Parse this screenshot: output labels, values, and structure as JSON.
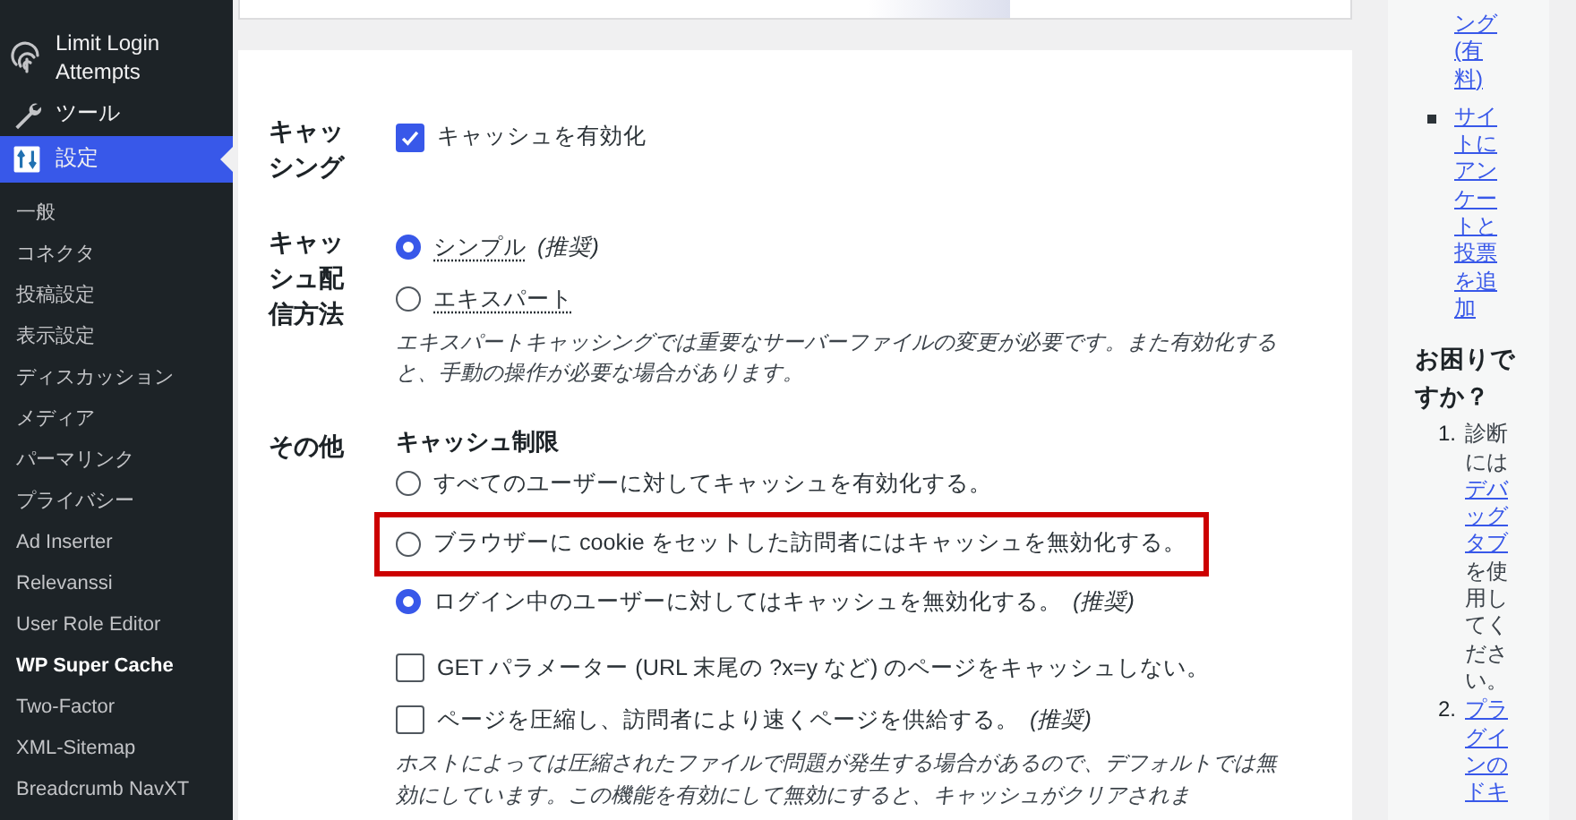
{
  "sidebar": {
    "menu": [
      {
        "label": "Limit Login Attempts",
        "selected": false
      },
      {
        "label": "ツール",
        "selected": false
      },
      {
        "label": "設定",
        "selected": true
      }
    ],
    "submenu": [
      {
        "label": "一般",
        "selected": false
      },
      {
        "label": "コネクタ",
        "selected": false
      },
      {
        "label": "投稿設定",
        "selected": false
      },
      {
        "label": "表示設定",
        "selected": false
      },
      {
        "label": "ディスカッション",
        "selected": false
      },
      {
        "label": "メディア",
        "selected": false
      },
      {
        "label": "パーマリンク",
        "selected": false
      },
      {
        "label": "プライバシー",
        "selected": false
      },
      {
        "label": "Ad Inserter",
        "selected": false
      },
      {
        "label": "Relevanssi",
        "selected": false
      },
      {
        "label": "User Role Editor",
        "selected": false
      },
      {
        "label": "WP Super Cache",
        "selected": true
      },
      {
        "label": "Two-Factor",
        "selected": false
      },
      {
        "label": "XML-Sitemap",
        "selected": false
      },
      {
        "label": "Breadcrumb NavXT",
        "selected": false
      }
    ]
  },
  "settings": [
    {
      "label": "キャッシング",
      "controls": [
        {
          "kind": "checkbox",
          "label": "キャッシュを有効化",
          "checked": true
        }
      ]
    },
    {
      "label": "キャッシュ配信方法",
      "controls": [
        {
          "kind": "radio",
          "label": "シンプル",
          "suffix": "(推奨)",
          "hint": true,
          "selected": true
        },
        {
          "kind": "radio",
          "label": "エキスパート",
          "hint": true,
          "selected": false
        },
        {
          "kind": "note",
          "text": "エキスパートキャッシングでは重要なサーバーファイルの変更が必要です。また有効化すると、手動の操作が必要な場合があります。"
        }
      ]
    },
    {
      "label": "その他",
      "controls": [
        {
          "kind": "heading",
          "text": "キャッシュ制限"
        },
        {
          "kind": "radio",
          "label": "すべてのユーザーに対してキャッシュを有効化する。",
          "selected": false,
          "highlighted": false
        },
        {
          "kind": "radio",
          "label": "ブラウザーに cookie をセットした訪問者にはキャッシュを無効化する。",
          "selected": false,
          "highlighted": true
        },
        {
          "kind": "radio",
          "label": "ログイン中のユーザーに対してはキャッシュを無効化する。",
          "suffix": "(推奨)",
          "selected": true,
          "highlighted": false
        },
        {
          "kind": "spacer"
        },
        {
          "kind": "checkbox",
          "label": "GET パラメーター (URL 末尾の ?x=y など) のページをキャッシュしない。",
          "checked": false
        },
        {
          "kind": "checkbox",
          "label": "ページを圧縮し、訪問者により速くページを供給する。",
          "suffix": "(推奨)",
          "checked": false
        },
        {
          "kind": "note",
          "text": "ホストによっては圧縮されたファイルで問題が発生する場合があるので、デフォルトでは無効にしています。この機能を有効にして無効にすると、キャッシュがクリアされま"
        }
      ]
    }
  ],
  "side_panel": {
    "links": [
      {
        "text": "ング(有料)",
        "bullet": false
      },
      {
        "text": "サイトにアンケートと投票を追加",
        "bullet": true
      }
    ],
    "heading": "お困りですか？",
    "help": [
      {
        "number": "1.",
        "before": "診断には",
        "link": "デバッグタブ",
        "after": "を使用してください。"
      },
      {
        "number": "2.",
        "link": "プラグインのドキ"
      }
    ]
  }
}
